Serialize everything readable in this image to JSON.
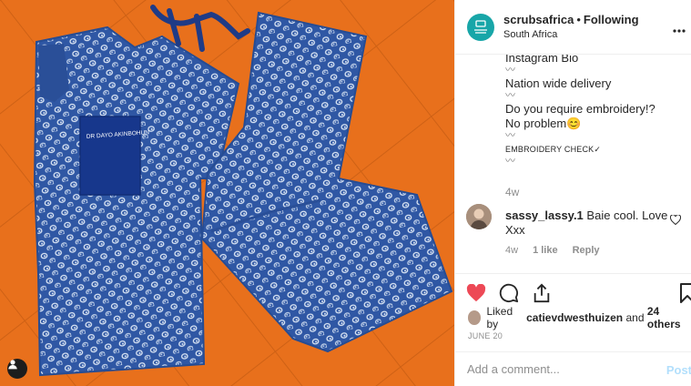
{
  "post": {
    "username": "scrubsafrica",
    "follow_status": "Following",
    "location": "South Africa",
    "photo_name_tag": "DR DAYO AKINBOHUN"
  },
  "caption": {
    "line_bio": "Instagram Bio",
    "squiggle": "〰",
    "line_delivery": "Nation wide delivery",
    "line_embroidery_q": "Do you require embroidery!?",
    "line_no_problem": "No problem😊",
    "line_check": "EMBROIDERY CHECK✓",
    "time": "4w"
  },
  "comment": {
    "user": "sassy_lassy.1",
    "text": "Baie cool. Love d",
    "text2": "Xxx",
    "time": "4w",
    "likes": "1 like",
    "reply": "Reply"
  },
  "likes": {
    "prefix": "Liked by",
    "user": "catievdwesthuizen",
    "suffix": "and",
    "others": "24 others"
  },
  "date": "JUNE 20",
  "add_comment": {
    "placeholder": "Add a comment...",
    "post_label": "Post"
  },
  "colors": {
    "background_orange": "#e8701c",
    "fabric_blue": "#2f57a4",
    "like_red": "#ed4956",
    "link_blue": "#b2dffc",
    "logo_teal": "#18a6a8"
  },
  "icons": [
    "more-icon",
    "heart-icon",
    "comment-icon",
    "share-icon",
    "bookmark-icon",
    "user-tag-icon"
  ]
}
